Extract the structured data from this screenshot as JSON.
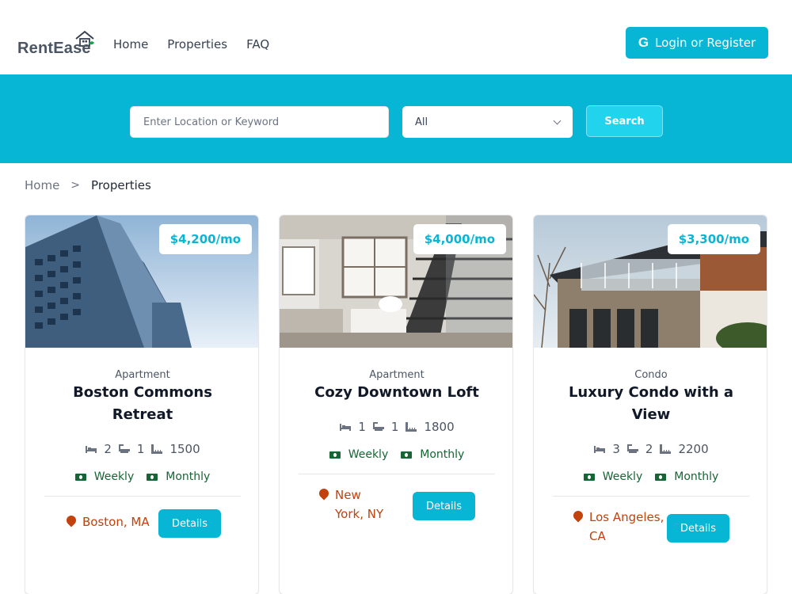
{
  "brand": {
    "name": "RentEase",
    "accent": "#06b6d4"
  },
  "nav": {
    "items": [
      "Home",
      "Properties",
      "FAQ"
    ]
  },
  "auth": {
    "login_label": "Login or Register"
  },
  "search": {
    "placeholder": "Enter Location or Keyword",
    "type_value": "All",
    "button_label": "Search"
  },
  "breadcrumb": {
    "home": "Home",
    "separator": ">",
    "current": "Properties"
  },
  "listings": [
    {
      "price": "$4,200/mo",
      "type": "Apartment",
      "title": "Boston Commons Retreat",
      "beds": "2",
      "baths": "1",
      "sqft": "1500",
      "rate_weekly": "Weekly",
      "rate_monthly": "Monthly",
      "location": "Boston, MA",
      "details_label": "Details"
    },
    {
      "price": "$4,000/mo",
      "type": "Apartment",
      "title": "Cozy Downtown Loft",
      "beds": "1",
      "baths": "1",
      "sqft": "1800",
      "rate_weekly": "Weekly",
      "rate_monthly": "Monthly",
      "location": "New York, NY",
      "details_label": "Details"
    },
    {
      "price": "$3,300/mo",
      "type": "Condo",
      "title": "Luxury Condo with a View",
      "beds": "3",
      "baths": "2",
      "sqft": "2200",
      "rate_weekly": "Weekly",
      "rate_monthly": "Monthly",
      "location": "Los Angeles, CA",
      "details_label": "Details"
    }
  ]
}
